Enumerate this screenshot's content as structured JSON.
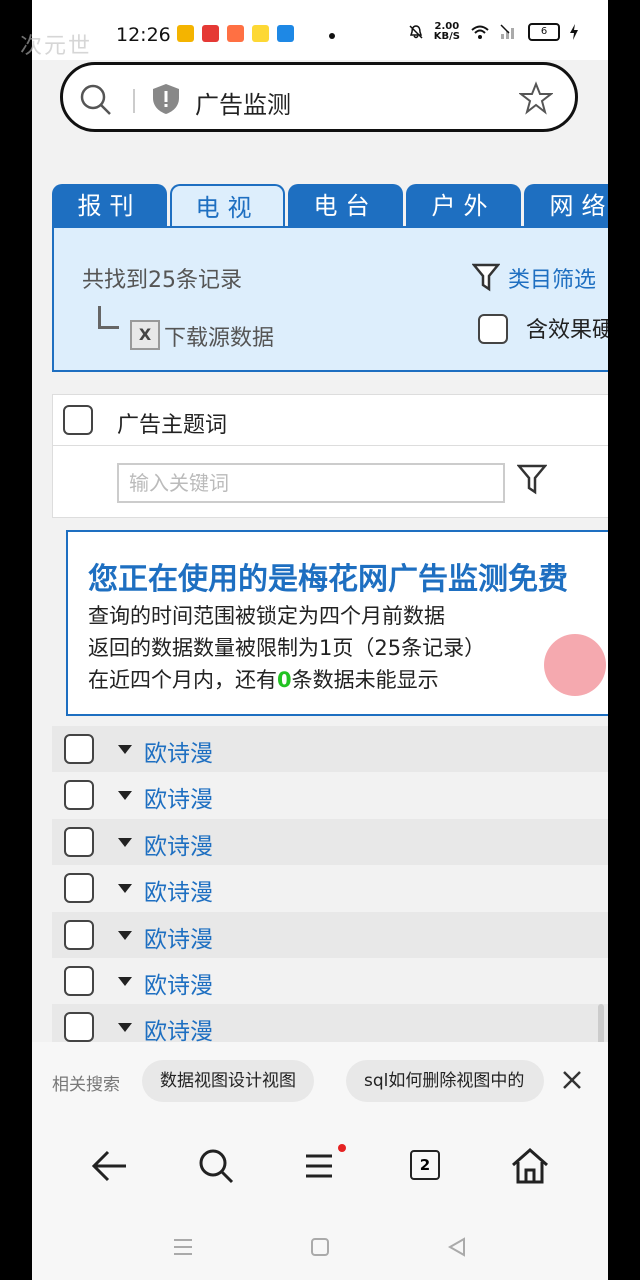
{
  "overlay": {
    "watermark": "次元世"
  },
  "status_bar": {
    "time": "12:26",
    "net_speed_value": "2.00",
    "net_speed_unit": "KB/S",
    "battery": "6"
  },
  "address_bar": {
    "title": "广告监测"
  },
  "tabs": [
    {
      "label": "报刊",
      "active": false
    },
    {
      "label": "电视",
      "active": true
    },
    {
      "label": "电台",
      "active": false
    },
    {
      "label": "户外",
      "active": false
    },
    {
      "label": "网络",
      "active": false
    }
  ],
  "filter": {
    "records_found": "共找到25条记录",
    "download_label": "下载源数据",
    "xls_icon_text": "X",
    "category_filter": "类目筛选",
    "effect_label": "含效果硬"
  },
  "table": {
    "header": "广告主题词",
    "keyword_placeholder": "输入关键词"
  },
  "notice": {
    "title": "您正在使用的是梅花网广告监测免费",
    "line1": "查询的时间范围被锁定为四个月前数据",
    "line2": "返回的数据数量被限制为1页（25条记录）",
    "line3_prefix": "在近四个月内，还有",
    "line3_count": "0",
    "line3_suffix": "条数据未能显示"
  },
  "rows": [
    "欧诗漫",
    "欧诗漫",
    "欧诗漫",
    "欧诗漫",
    "欧诗漫",
    "欧诗漫",
    "欧诗漫"
  ],
  "related_search": {
    "label": "相关搜索",
    "chips": [
      "数据视图设计视图",
      "sql如何删除视图中的"
    ]
  },
  "nav": {
    "tab_count": "2"
  },
  "colors": {
    "accent": "#1e6fc1",
    "tab_light": "#ddeefc",
    "green": "#22c322"
  }
}
